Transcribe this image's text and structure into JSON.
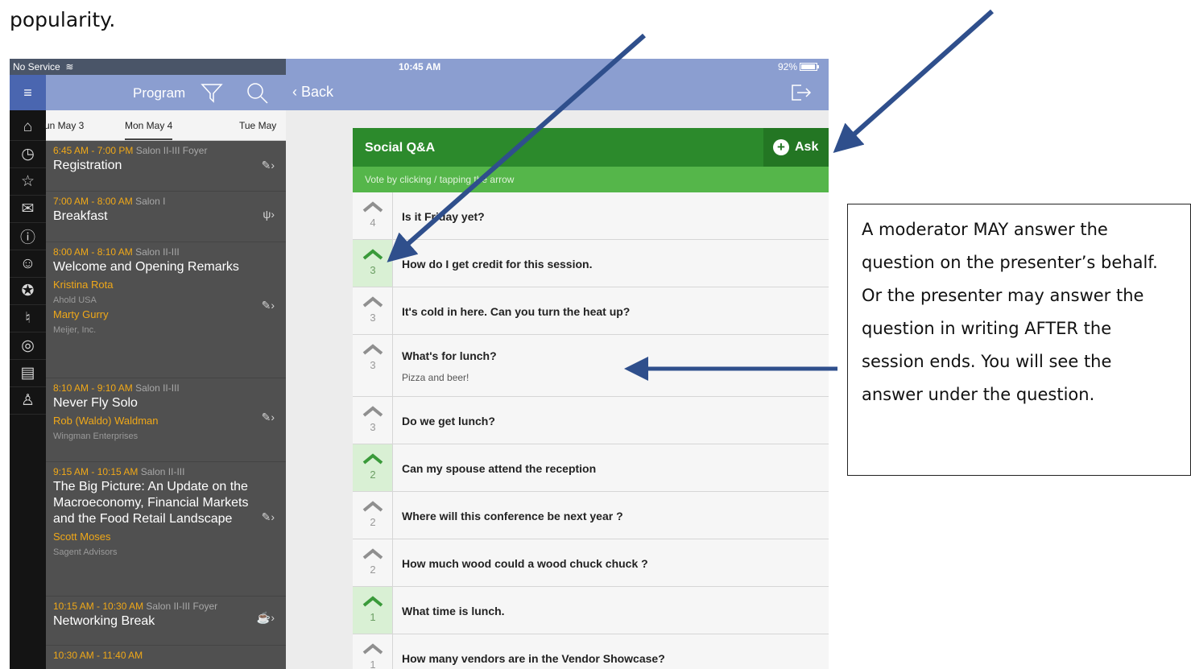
{
  "doc_text": "popularity.",
  "status_bar": {
    "carrier": "No Service",
    "time": "10:45 AM",
    "battery": "92%"
  },
  "left_nav": {
    "icons": [
      "menu-icon",
      "home-icon",
      "clock-icon",
      "star-icon",
      "mail-icon",
      "info-icon",
      "people-icon",
      "awards-icon",
      "microphone-icon",
      "location-icon",
      "presentation-icon",
      "person-icon"
    ]
  },
  "program": {
    "title": "Program",
    "tabs": [
      "un May 3",
      "Mon  May 4",
      "Tue  May"
    ],
    "sessions": [
      {
        "time": "6:45 AM - 7:00 PM",
        "room": "Salon II-III Foyer",
        "title": "Registration",
        "speakers": [],
        "icon": "✎›"
      },
      {
        "time": "7:00 AM - 8:00 AM",
        "room": "Salon I",
        "title": "Breakfast",
        "speakers": [],
        "icon": "ψ›"
      },
      {
        "time": "8:00 AM - 8:10 AM",
        "room": "Salon II-III",
        "title": "Welcome and Opening Remarks",
        "speakers": [
          {
            "name": "Kristina Rota",
            "org": "Ahold USA"
          },
          {
            "name": "Marty Gurry",
            "org": "Meijer, Inc."
          }
        ],
        "icon": "✎›"
      },
      {
        "time": "8:10 AM - 9:10 AM",
        "room": "Salon II-III",
        "title": "Never Fly Solo",
        "speakers": [
          {
            "name": "Rob (Waldo) Waldman",
            "org": "Wingman Enterprises"
          }
        ],
        "icon": "✎›"
      },
      {
        "time": "9:15 AM - 10:15 AM",
        "room": "Salon II-III",
        "title": "The Big Picture: An Update on the Macroeconomy, Financial Markets and the Food Retail Landscape",
        "speakers": [
          {
            "name": "Scott Moses",
            "org": "Sagent Advisors"
          }
        ],
        "icon": "✎›"
      },
      {
        "time": "10:15 AM - 10:30 AM",
        "room": "Salon II-III Foyer",
        "title": "Networking Break",
        "speakers": [],
        "icon": "☕›"
      },
      {
        "time": "10:30 AM - 11:40 AM",
        "room": "",
        "title": "",
        "speakers": [],
        "icon": ""
      }
    ]
  },
  "nav": {
    "back_label": "Back"
  },
  "qa": {
    "title": "Social Q&A",
    "ask_label": "Ask",
    "subheader": "Vote by clicking / tapping the arrow",
    "questions": [
      {
        "text": "Is it Friday yet?",
        "votes": 4,
        "voted": false,
        "answer": ""
      },
      {
        "text": "How do I get credit for this session.",
        "votes": 3,
        "voted": true,
        "answer": ""
      },
      {
        "text": "It's cold in here. Can you turn the heat up?",
        "votes": 3,
        "voted": false,
        "answer": ""
      },
      {
        "text": "What's for lunch?",
        "votes": 3,
        "voted": false,
        "answer": "Pizza and beer!"
      },
      {
        "text": "Do we get lunch?",
        "votes": 3,
        "voted": false,
        "answer": ""
      },
      {
        "text": "Can my spouse attend the reception",
        "votes": 2,
        "voted": true,
        "answer": ""
      },
      {
        "text": "Where will this conference be next year ?",
        "votes": 2,
        "voted": false,
        "answer": ""
      },
      {
        "text": "How much wood could a wood chuck chuck ?",
        "votes": 2,
        "voted": false,
        "answer": ""
      },
      {
        "text": "What time is lunch.",
        "votes": 1,
        "voted": true,
        "answer": ""
      },
      {
        "text": "How many vendors are in the Vendor Showcase?",
        "votes": 1,
        "voted": false,
        "answer": ""
      }
    ]
  },
  "callout": {
    "text": "A moderator MAY answer the question on the presenter’s behalf. Or the presenter may answer the question in writing AFTER the session ends. You will see the answer under the question."
  },
  "colors": {
    "nav_blue": "#8b9ed0",
    "qa_green": "#2c8a2c",
    "subheader_green": "#55b64a",
    "vote_green": "#3a9a3a",
    "schedule_orange": "#f0a818",
    "arrow_blue": "#2f4f8c"
  }
}
